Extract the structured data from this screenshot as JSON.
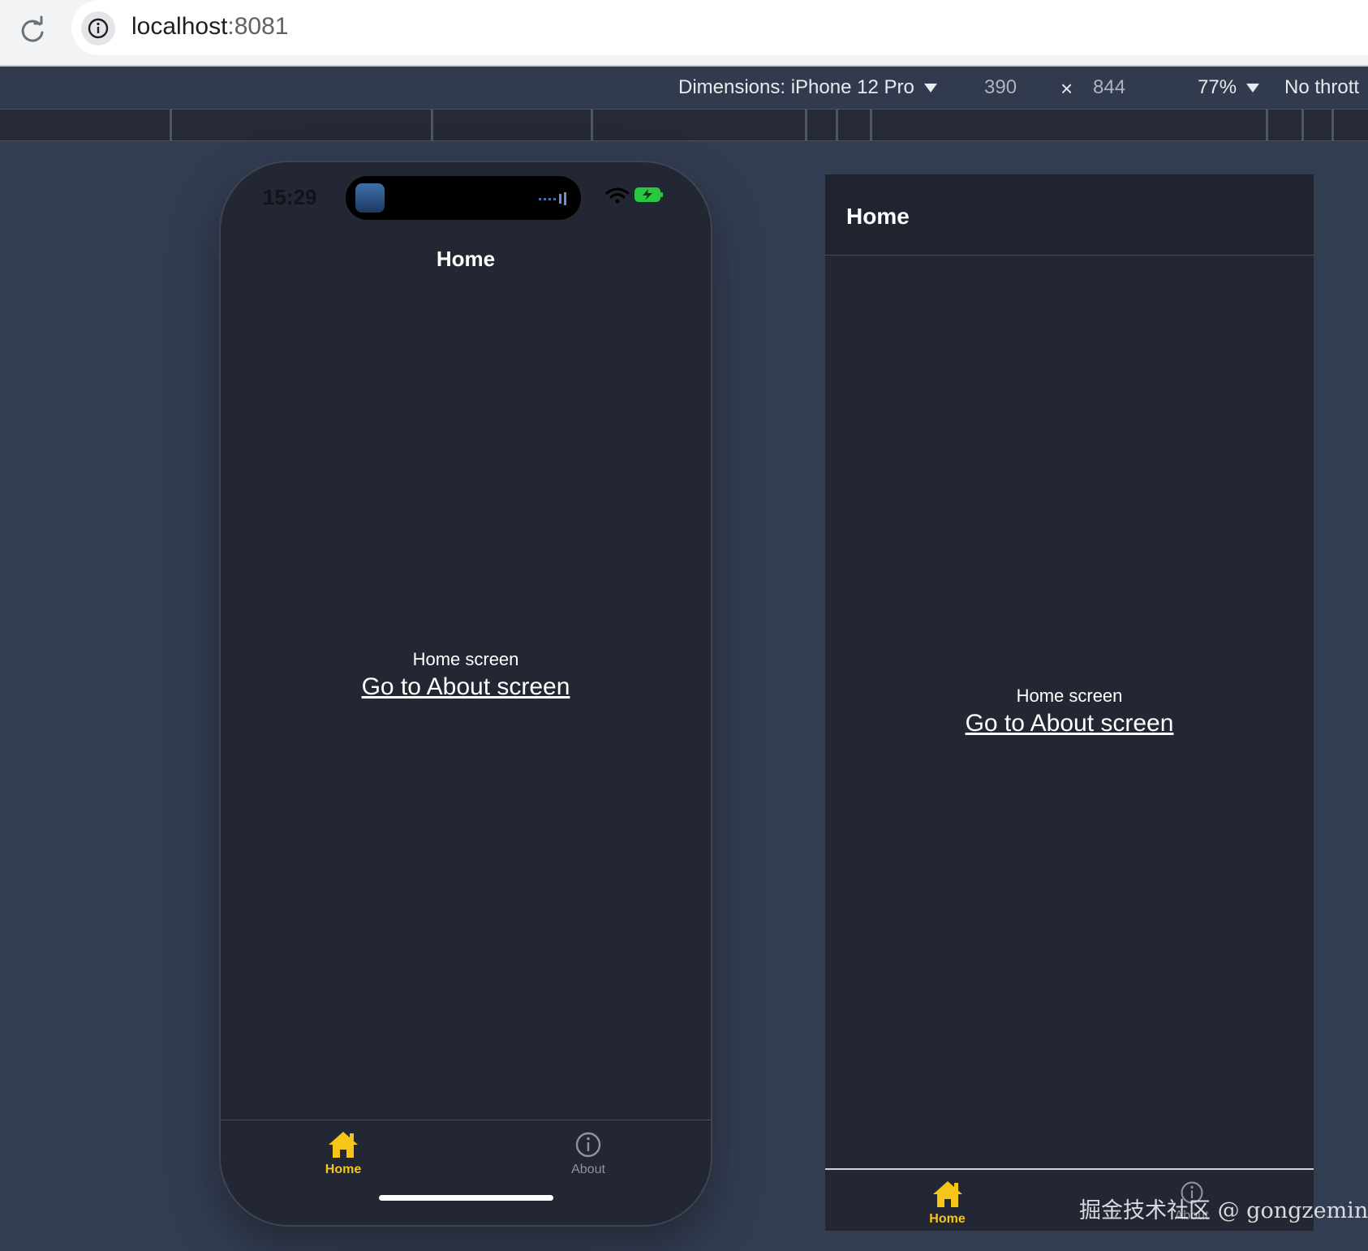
{
  "browser": {
    "url_host": "localhost",
    "url_port": ":8081"
  },
  "devtools": {
    "dimensions_label": "Dimensions: iPhone 12 Pro",
    "width": "390",
    "times": "×",
    "height": "844",
    "zoom": "77%",
    "throttle": "No thrott"
  },
  "phone": {
    "status_time": "15:29",
    "header_title": "Home",
    "screen_label": "Home screen",
    "link_label": "Go to About screen",
    "tabs": [
      {
        "label": "Home",
        "icon": "home-icon",
        "active": true
      },
      {
        "label": "About",
        "icon": "info-icon",
        "active": false
      }
    ]
  },
  "preview": {
    "header_title": "Home",
    "screen_label": "Home screen",
    "link_label": "Go to About screen",
    "tabs": [
      {
        "label": "Home",
        "icon": "home-icon",
        "active": true
      },
      {
        "label": "About",
        "icon": "info-icon",
        "active": false
      }
    ]
  },
  "watermark": "掘金技术社区 @ gongzemin",
  "colors": {
    "accent_tab": "#f5c518",
    "screen_bg": "#232733",
    "page_bg": "#333d52"
  }
}
